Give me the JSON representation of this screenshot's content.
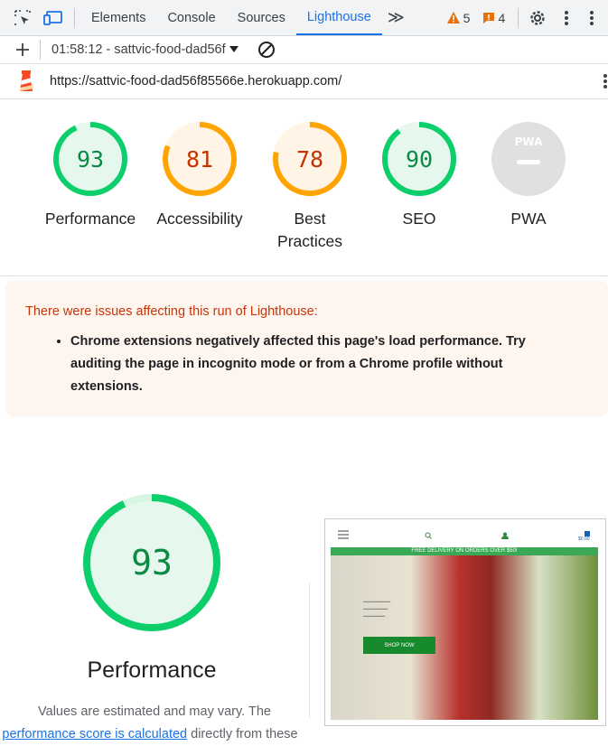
{
  "toolbar": {
    "tabs": [
      "Elements",
      "Console",
      "Sources",
      "Lighthouse"
    ],
    "active_tab": "Lighthouse",
    "more": "≫",
    "warning_count": "5",
    "issue_count": "4"
  },
  "subbar": {
    "report": "01:58:12 - sattvic-food-dad56f"
  },
  "url": "https://sattvic-food-dad56f85566e.herokuapp.com/",
  "gauges": [
    {
      "score": "93",
      "label": "Performance",
      "status": "pass",
      "value": 0.93
    },
    {
      "score": "81",
      "label": "Accessibility",
      "status": "average",
      "value": 0.81
    },
    {
      "score": "78",
      "label": "Best\nPractices",
      "status": "average",
      "value": 0.78
    },
    {
      "score": "90",
      "label": "SEO",
      "status": "pass",
      "value": 0.9
    },
    {
      "score": "",
      "label": "PWA",
      "status": "na",
      "value": 0
    }
  ],
  "colors": {
    "pass": "#0cce6b",
    "pass_text": "#0a8a43",
    "average": "#ffa400",
    "average_text": "#c33300",
    "na": "#e0e0e0"
  },
  "warning": {
    "title": "There were issues affecting this run of Lighthouse:",
    "items": [
      "Chrome extensions negatively affected this page's load performance. Try auditing the page in incognito mode or from a Chrome profile without extensions."
    ]
  },
  "performance": {
    "score": "93",
    "value": 0.93,
    "title": "Performance",
    "note_prefix": "Values are estimated and may vary. The",
    "note_link": "performance score is calculated",
    "note_suffix": "directly from these"
  },
  "screenshot": {
    "banner": "FREE DELIVERY ON ORDERS OVER $50!",
    "shop_button": "SHOP NOW",
    "bag_amount": "$0.00"
  }
}
